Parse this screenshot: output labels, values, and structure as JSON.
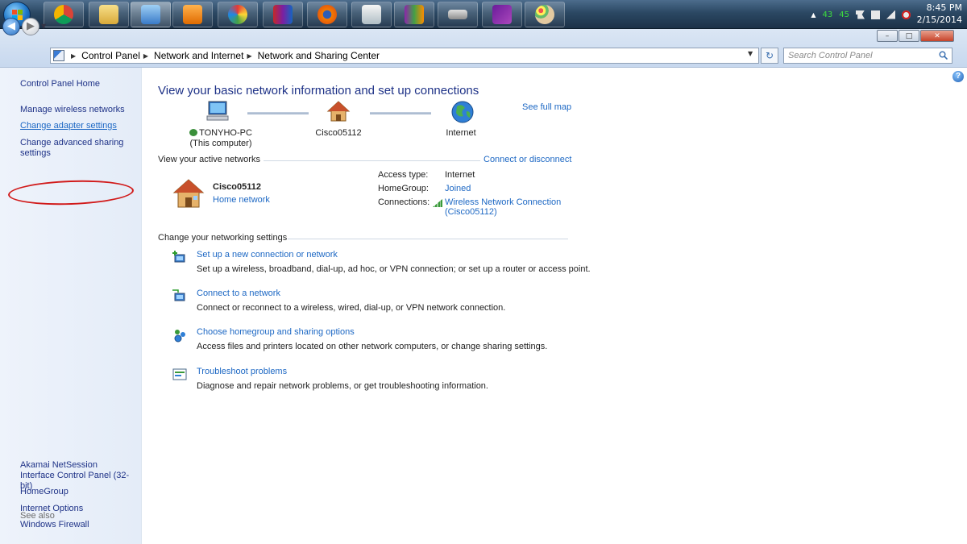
{
  "taskbar": {
    "tray": {
      "num1": "43",
      "num2": "45"
    },
    "clock": {
      "time": "8:45 PM",
      "date": "2/15/2014"
    }
  },
  "window": {
    "controls": {
      "minimize": "–",
      "restore": "□",
      "close": "✕"
    }
  },
  "address": {
    "crumbs": [
      "Control Panel",
      "Network and Internet",
      "Network and Sharing Center"
    ],
    "search_placeholder": "Search Control Panel"
  },
  "leftnav": {
    "home": "Control Panel Home",
    "links": [
      "Manage wireless networks",
      "Change adapter settings",
      "Change advanced sharing settings"
    ],
    "see_also_title": "See also",
    "see_also": [
      "Akamai NetSession Interface Control Panel (32-bit)",
      "HomeGroup",
      "Internet Options",
      "Windows Firewall"
    ]
  },
  "main": {
    "title": "View your basic network information and set up connections",
    "see_full_map": "See full map",
    "map": {
      "computer_name": "TONYHO-PC",
      "computer_sub": "(This computer)",
      "network_name": "Cisco05112",
      "internet": "Internet"
    },
    "active_networks": {
      "heading": "View your active networks",
      "connect_link": "Connect or disconnect",
      "network_name": "Cisco05112",
      "network_type": "Home network",
      "access_type_label": "Access type:",
      "access_type_value": "Internet",
      "homegroup_label": "HomeGroup:",
      "homegroup_value": "Joined",
      "connections_label": "Connections:",
      "connection_value": "Wireless Network Connection",
      "connection_sub": "(Cisco05112)"
    },
    "settings": {
      "heading": "Change your networking settings",
      "tasks": [
        {
          "link": "Set up a new connection or network",
          "desc": "Set up a wireless, broadband, dial-up, ad hoc, or VPN connection; or set up a router or access point."
        },
        {
          "link": "Connect to a network",
          "desc": "Connect or reconnect to a wireless, wired, dial-up, or VPN network connection."
        },
        {
          "link": "Choose homegroup and sharing options",
          "desc": "Access files and printers located on other network computers, or change sharing settings."
        },
        {
          "link": "Troubleshoot problems",
          "desc": "Diagnose and repair network problems, or get troubleshooting information."
        }
      ]
    }
  },
  "colors": {
    "link": "#1d68c4",
    "nav_bg": "#e4ecf8",
    "annotation_red": "#d11a1a"
  }
}
